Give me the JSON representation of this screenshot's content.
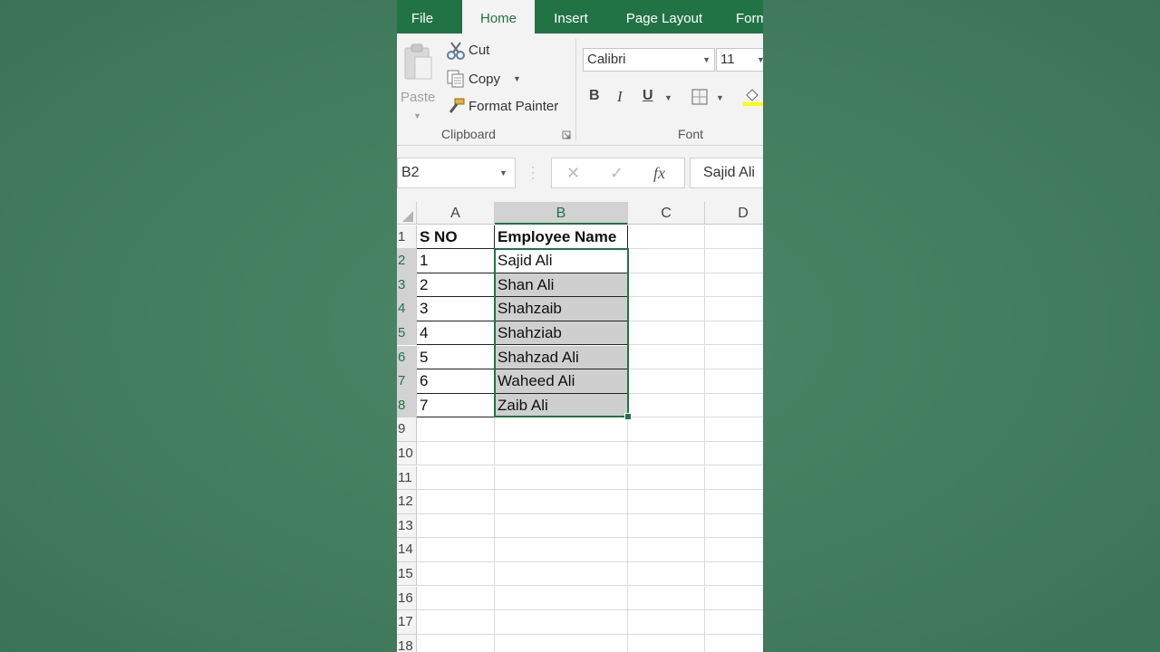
{
  "ribbon": {
    "tabs": [
      "File",
      "Home",
      "Insert",
      "Page Layout",
      "Form"
    ],
    "active_tab": "Home",
    "clipboard": {
      "paste_label": "Paste",
      "cut_label": "Cut",
      "copy_label": "Copy",
      "format_painter_label": "Format Painter",
      "group_label": "Clipboard"
    },
    "font": {
      "font_name": "Calibri",
      "font_size": "11",
      "bold_label": "B",
      "italic_label": "I",
      "underline_label": "U",
      "group_label": "Font"
    }
  },
  "formula_bar": {
    "name_box": "B2",
    "fx_label": "fx",
    "content": "Sajid Ali"
  },
  "grid": {
    "columns": [
      "A",
      "B",
      "C",
      "D"
    ],
    "selected_column": "B",
    "row_numbers": [
      "1",
      "2",
      "3",
      "4",
      "5",
      "6",
      "7",
      "8",
      "9",
      "10",
      "11",
      "12",
      "13",
      "14",
      "15",
      "16",
      "17",
      "18"
    ],
    "header_row": [
      "S NO",
      "Employee Name"
    ],
    "rows": [
      [
        "1",
        "Sajid Ali"
      ],
      [
        "2",
        "Shan Ali"
      ],
      [
        "3",
        "Shahzaib"
      ],
      [
        "4",
        "Shahziab"
      ],
      [
        "5",
        "Shahzad Ali"
      ],
      [
        "6",
        "Waheed Ali"
      ],
      [
        "7",
        "Zaib Ali"
      ]
    ],
    "selection": "B2:B8"
  },
  "colors": {
    "accent": "#217346",
    "selection_fill": "#cfcfcf",
    "background": "#447e60"
  }
}
